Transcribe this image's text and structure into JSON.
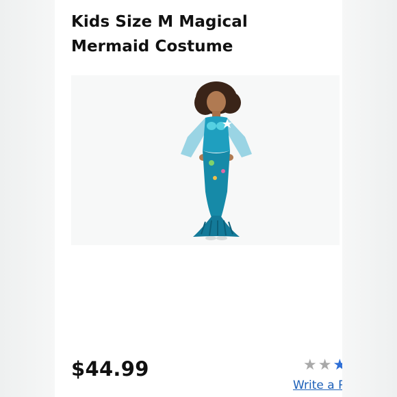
{
  "product": {
    "title": "Kids Size M Magical Mermaid Costume",
    "price": "$44.99",
    "image_alt": "Child wearing a teal mermaid costume with sheer sleeves and a fin skirt"
  },
  "reviews": {
    "stars_visible": 3,
    "write_review_label": "Write a R"
  },
  "colors": {
    "costume_teal": "#1f9fbf",
    "link_blue": "#1b5fb8",
    "star_gray": "#a9a9a9"
  }
}
